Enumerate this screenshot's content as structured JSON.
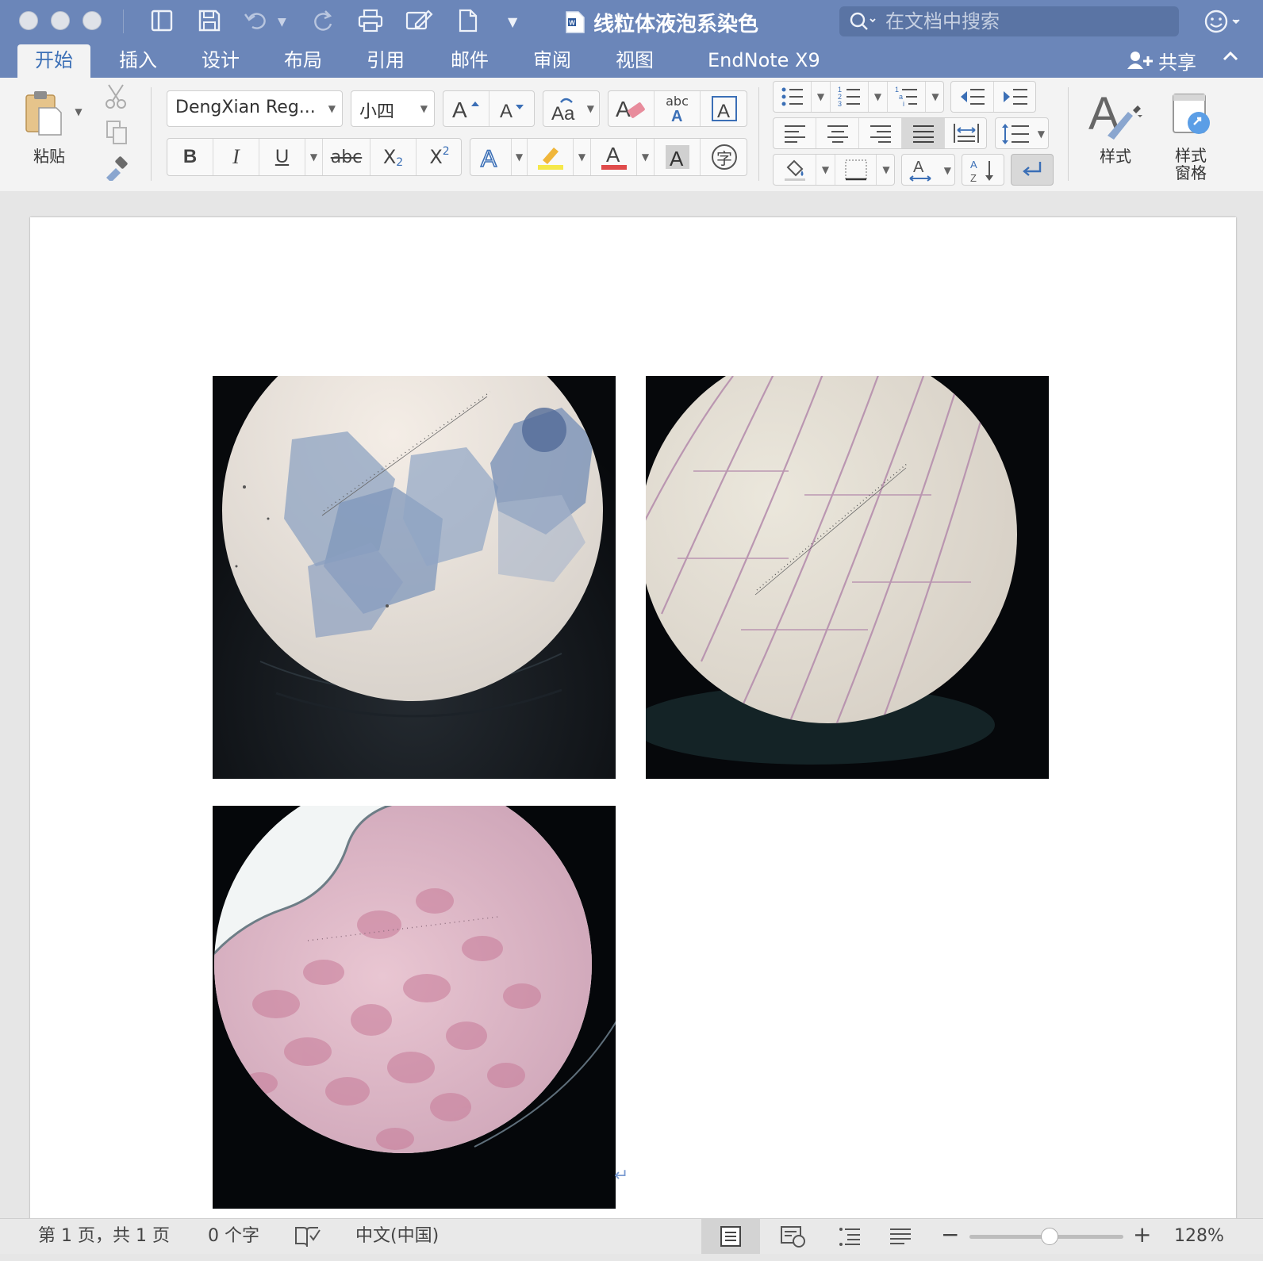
{
  "window": {
    "title": "线粒体液泡系染色"
  },
  "search": {
    "placeholder": "在文档中搜索"
  },
  "tabs": [
    "开始",
    "插入",
    "设计",
    "布局",
    "引用",
    "邮件",
    "审阅",
    "视图",
    "EndNote X9"
  ],
  "active_tab": "开始",
  "share_label": "共享",
  "ribbon": {
    "paste_label": "粘贴",
    "font_name": "DengXian Reg...",
    "font_size": "小四",
    "styles_label": "样式",
    "styles_pane_label_1": "样式",
    "styles_pane_label_2": "窗格",
    "bold": "B",
    "italic": "I",
    "underline": "U",
    "strike": "abc",
    "subscript_base": "X",
    "subscript_mark": "2",
    "superscript_base": "X",
    "superscript_mark": "2",
    "phonetic_char": "字",
    "abc_label": "abc"
  },
  "document": {
    "images": [
      {
        "name": "micrograph-blue-stained-cells"
      },
      {
        "name": "micrograph-pink-elongated-cells"
      },
      {
        "name": "micrograph-pink-tissue"
      }
    ]
  },
  "status": {
    "page_info": "第 1 页，共 1 页",
    "word_count": "0 个字",
    "language": "中文(中国)",
    "zoom_percent": "128%",
    "zoom_level": 0.52
  },
  "colors": {
    "titlebar": "#6b86b9",
    "accent": "#3b6fb6",
    "highlight": "#f5e84a",
    "font_color": "#e04b4b"
  }
}
